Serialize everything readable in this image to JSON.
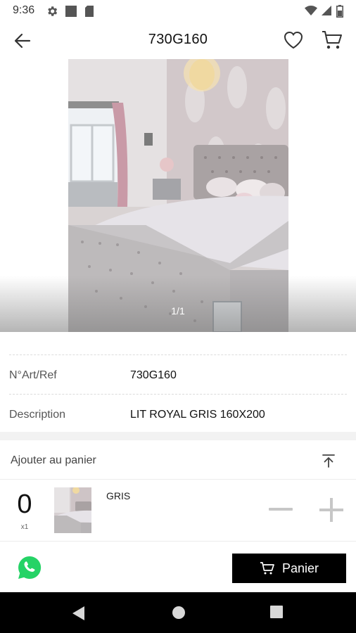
{
  "status_bar": {
    "time": "9:36",
    "icons": [
      "settings-icon",
      "square-icon",
      "sd-card-icon",
      "wifi-icon",
      "signal-icon",
      "battery-icon"
    ]
  },
  "app_bar": {
    "title": "730G160",
    "icons": [
      "back-arrow-icon",
      "heart-icon",
      "cart-icon"
    ]
  },
  "gallery": {
    "counter": "1/1"
  },
  "details": [
    {
      "label": "N°Art/Ref",
      "value": "730G160"
    },
    {
      "label": "Description",
      "value": "LIT ROYAL GRIS 160X200"
    }
  ],
  "cart_section": {
    "title": "Ajouter au panier",
    "variant": {
      "quantity": "0",
      "multiplier": "x1",
      "name": "GRIS"
    }
  },
  "bottom_bar": {
    "panier_label": "Panier"
  },
  "colors": {
    "button_bg": "#000000",
    "whatsapp_green": "#25D366",
    "stepper_gray": "#c7c7c7"
  }
}
